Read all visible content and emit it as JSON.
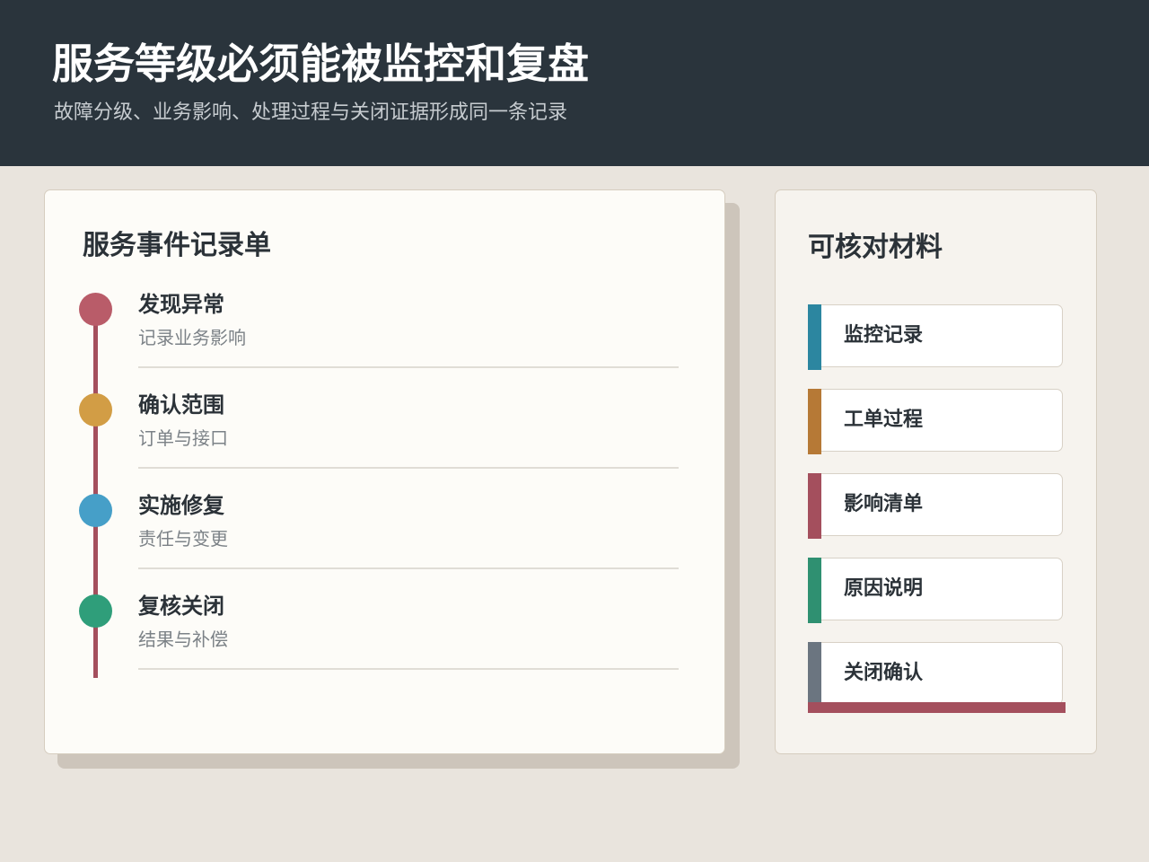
{
  "header": {
    "title": "服务等级必须能被监控和复盘",
    "subtitle": "故障分级、业务影响、处理过程与关闭证据形成同一条记录"
  },
  "record": {
    "title": "服务事件记录单",
    "steps": [
      {
        "title": "发现异常",
        "desc": "记录业务影响",
        "color": "#b95c69"
      },
      {
        "title": "确认范围",
        "desc": "订单与接口",
        "color": "#d29d45"
      },
      {
        "title": "实施修复",
        "desc": "责任与变更",
        "color": "#469fc8"
      },
      {
        "title": "复核关闭",
        "desc": "结果与补偿",
        "color": "#2f9e7a"
      }
    ]
  },
  "materials": {
    "title": "可核对材料",
    "items": [
      {
        "label": "监控记录",
        "color": "#2c86a0"
      },
      {
        "label": "工单过程",
        "color": "#b67936"
      },
      {
        "label": "影响清单",
        "color": "#a44f5d"
      },
      {
        "label": "原因说明",
        "color": "#2f9071"
      },
      {
        "label": "关闭确认",
        "color": "#6b7580"
      }
    ]
  }
}
